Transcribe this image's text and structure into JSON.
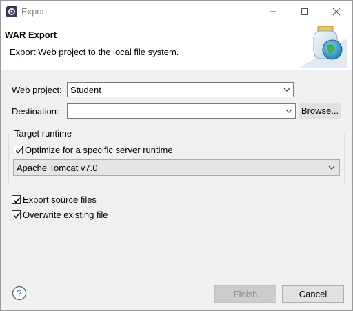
{
  "window": {
    "title": "Export",
    "minimize_icon": "minimize-icon",
    "maximize_icon": "maximize-icon",
    "close_icon": "close-icon"
  },
  "banner": {
    "title": "WAR Export",
    "description": "Export Web project to the local file system.",
    "graphic_icon": "jar-globe-icon"
  },
  "form": {
    "web_project_label": "Web project:",
    "web_project_value": "Student",
    "destination_label": "Destination:",
    "destination_value": "",
    "browse_label": "Browse..."
  },
  "target_runtime": {
    "group_title": "Target runtime",
    "optimize_label": "Optimize for a specific server runtime",
    "optimize_checked": true,
    "runtime_value": "Apache Tomcat v7.0"
  },
  "options": {
    "export_source_label": "Export source files",
    "export_source_checked": true,
    "overwrite_label": "Overwrite existing file",
    "overwrite_checked": true
  },
  "footer": {
    "help_icon": "help-icon",
    "finish_label": "Finish",
    "finish_enabled": false,
    "cancel_label": "Cancel"
  },
  "colors": {
    "window_bg": "#f0f0f0",
    "banner_bg": "#ffffff",
    "disabled_button_bg": "#cccccc",
    "disabled_text": "#8e8e8e",
    "help_blue": "#3c6fb3"
  }
}
